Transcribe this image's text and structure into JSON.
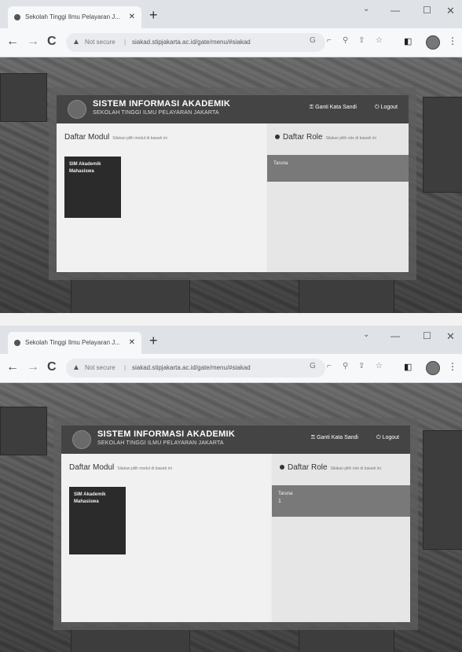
{
  "shots": [
    {
      "tab_title": "Sekolah Tinggi Ilmu Pelayaran J...",
      "new_tab": "+",
      "url_prefix": "Not secure",
      "url": "siakad.stipjakarta.ac.id/gate/menu/#siakad",
      "app": {
        "title": "SISTEM INFORMASI AKADEMIK",
        "subtitle": "SEKOLAH TINGGI ILMU PELAYARAN JAKARTA",
        "change_password": "Ganti Kata Sandi",
        "logout": "Logout",
        "modul_heading": "Daftar Modul",
        "modul_hint": "Silakan pilih modul di bawah ini",
        "modul_tile": "SIM Akademik Mahasiswa",
        "role_heading": "Daftar Role",
        "role_hint": "Silakan pilih role di bawah ini",
        "role_item": "Taruna",
        "role_item_count": ""
      }
    },
    {
      "tab_title": "Sekolah Tinggi Ilmu Pelayaran J...",
      "new_tab": "+",
      "url_prefix": "Not secure",
      "url": "siakad.stipjakarta.ac.id/gate/menu/#siakad",
      "app": {
        "title": "SISTEM INFORMASI AKADEMIK",
        "subtitle": "SEKOLAH TINGGI ILMU PELAYARAN JAKARTA",
        "change_password": "Ganti Kata Sandi",
        "logout": "Logout",
        "modul_heading": "Daftar Modul",
        "modul_hint": "Silakan pilih modul di bawah ini",
        "modul_tile": "SIM Akademik Mahasiswa",
        "role_heading": "Daftar Role",
        "role_hint": "Silakan pilih role di bawah ini",
        "role_item": "Taruna",
        "role_item_count": "1"
      }
    }
  ],
  "icons": {
    "back": "back-arrow-icon",
    "forward": "forward-arrow-icon",
    "reload": "reload-icon",
    "warning": "warning-icon",
    "key": "key-icon",
    "logout": "logout-icon",
    "logo": "logo-icon"
  }
}
